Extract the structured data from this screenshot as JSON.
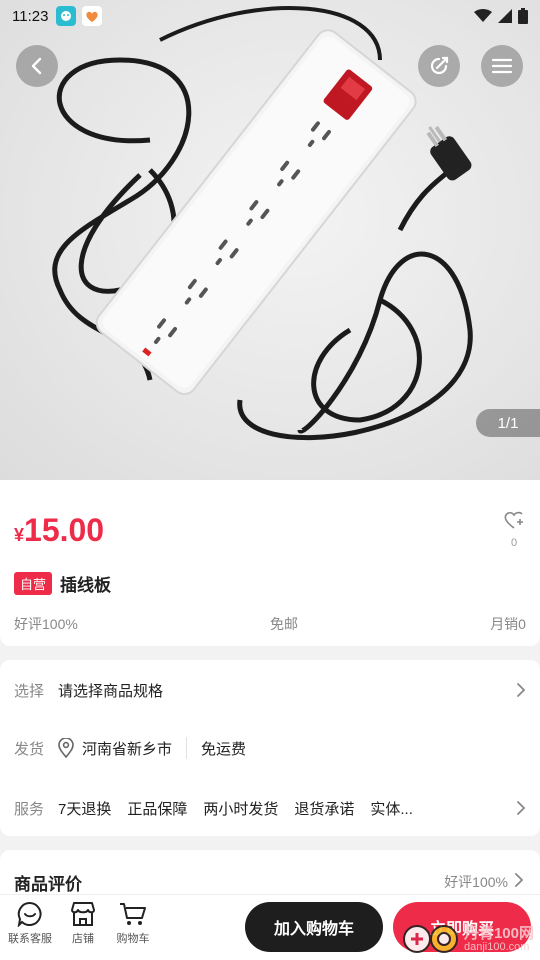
{
  "status_bar": {
    "time": "11:23"
  },
  "gallery": {
    "counter": "1/1"
  },
  "product": {
    "price_symbol": "¥",
    "price": "15.00",
    "favorites_count": "0",
    "badge": "自营",
    "title": "插线板",
    "rating": "好评100%",
    "shipping": "免邮",
    "monthly_sales": "月销0"
  },
  "specs": {
    "select_label": "选择",
    "select_value": "请选择商品规格",
    "ship_label": "发货",
    "ship_location": "河南省新乡市",
    "ship_fee": "免运费",
    "service_label": "服务",
    "services": [
      "7天退换",
      "正品保障",
      "两小时发货",
      "退货承诺",
      "实体..."
    ]
  },
  "reviews": {
    "title": "商品评价",
    "rating": "好评100%"
  },
  "bottom_bar": {
    "support": "联系客服",
    "store": "店铺",
    "cart": "购物车",
    "add_to_cart": "加入购物车",
    "buy_now": "立即购买"
  },
  "watermark": {
    "text": "丹青100网",
    "url": "danji100.com"
  },
  "colors": {
    "accent": "#ee2b48",
    "dark_button": "#1e1e1e"
  }
}
